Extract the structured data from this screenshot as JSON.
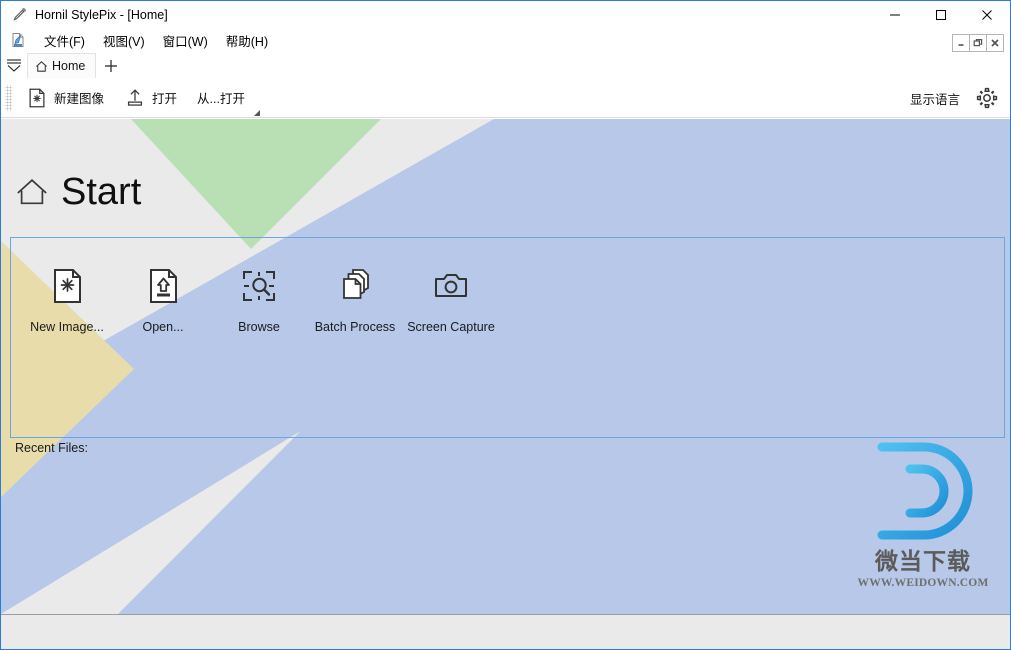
{
  "window": {
    "title": "Hornil StylePix - [Home]",
    "app_icon": "pencil-icon",
    "controls": [
      {
        "name": "minimize",
        "glyph": "—"
      },
      {
        "name": "maximize",
        "glyph": "☐"
      },
      {
        "name": "close",
        "glyph": "✕"
      }
    ]
  },
  "mdi_controls": [
    {
      "name": "mdi-minimize",
      "glyph": "–"
    },
    {
      "name": "mdi-restore",
      "glyph": "❐"
    },
    {
      "name": "mdi-close",
      "glyph": "✕"
    }
  ],
  "menubar": {
    "app_icon": "document-icon",
    "items": [
      {
        "label": "文件(F)",
        "accel": "F"
      },
      {
        "label": "视图(V)",
        "accel": "V"
      },
      {
        "label": "窗口(W)",
        "accel": "W"
      },
      {
        "label": "帮助(H)",
        "accel": "H"
      }
    ]
  },
  "tabs": {
    "dropdown_icon": "tab-list-dropdown-icon",
    "items": [
      {
        "label": "Home",
        "icon": "home-icon",
        "active": true
      }
    ],
    "add_label": "+"
  },
  "toolbar": {
    "buttons": [
      {
        "label": "新建图像",
        "icon": "new-image-icon"
      },
      {
        "label": "打开",
        "icon": "open-upload-icon"
      },
      {
        "label": "从...打开",
        "icon": ""
      }
    ],
    "language_label": "显示语言",
    "settings_icon": "gear-icon",
    "overflow_icon": "toolbar-overflow-icon"
  },
  "start_page": {
    "heading": "Start",
    "heading_icon": "home-icon",
    "actions": [
      {
        "label": "New Image...",
        "icon": "new-image-icon"
      },
      {
        "label": "Open...",
        "icon": "open-file-icon"
      },
      {
        "label": "Browse",
        "icon": "browse-icon"
      },
      {
        "label": "Batch Process",
        "icon": "batch-process-icon"
      },
      {
        "label": "Screen Capture",
        "icon": "camera-icon"
      }
    ],
    "recent_files_label": "Recent Files:",
    "recent_files": []
  },
  "watermark": {
    "logo": "D",
    "brand": "微当下载",
    "url": "WWW.WEIDOWN.COM"
  },
  "colors": {
    "canvas_bg": "#eaeaea",
    "green_shape": "#b9e0b5",
    "blue_shape": "#b7c8e8",
    "yellow_shape": "#e8dcab",
    "panel_border": "#6aa6e0",
    "window_border": "#2b7cd3",
    "watermark_blue_dark": "#1f8fd6",
    "watermark_blue_light": "#4fc0ef"
  }
}
